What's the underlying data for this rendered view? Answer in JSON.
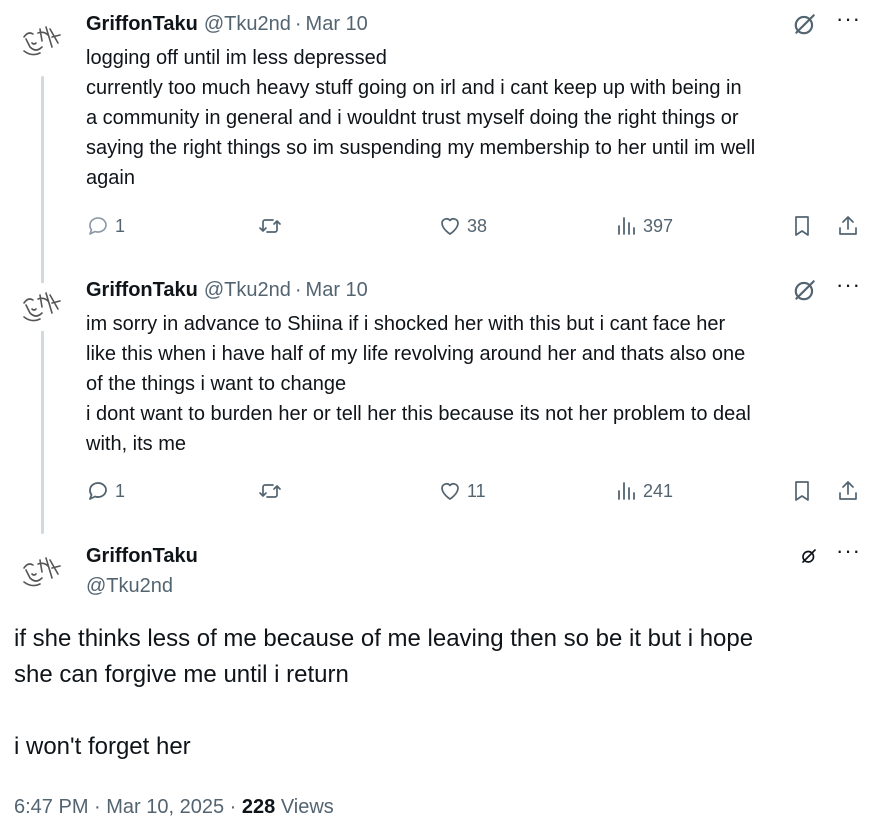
{
  "tweets": [
    {
      "name": "GriffonTaku",
      "handle": "@Tku2nd",
      "separator": "·",
      "date": "Mar 10",
      "lines": [
        "logging off until im less depressed",
        "currently too much heavy stuff going on irl and i cant keep up with being in",
        "a community in general and i wouldnt trust myself doing the right things or",
        "saying the right things so im suspending my membership to her until im well",
        "again"
      ],
      "replies": "1",
      "likes": "38",
      "views": "397"
    },
    {
      "name": "GriffonTaku",
      "handle": "@Tku2nd",
      "separator": "·",
      "date": "Mar 10",
      "lines": [
        "im sorry in advance to Shiina if i shocked her with this but i cant face her",
        "like this when i have half of my life revolving around her and thats also one",
        "of the things i want to change",
        "i dont want to burden her or tell her this because its not her problem to deal",
        "with, its me"
      ],
      "replies": "1",
      "likes": "11",
      "views": "241"
    }
  ],
  "main": {
    "name": "GriffonTaku",
    "handle": "@Tku2nd",
    "lines": [
      "if she thinks less of me because of me leaving then so be it but i hope",
      "she can forgive me until i return"
    ],
    "second_paragraph": "i won't forget her",
    "timestamp": "6:47 PM · Mar 10, 2025 · ",
    "views_count": "228",
    "views_label": " Views"
  },
  "icons": {
    "more": "more-icon",
    "grok": "grok-icon",
    "reply": "reply-icon",
    "retweet": "retweet-icon",
    "like": "like-icon",
    "views": "views-icon",
    "bookmark": "bookmark-icon",
    "share": "share-icon"
  },
  "colors": {
    "text": "#0f1419",
    "secondary": "#536471",
    "thread_line": "#cfd9de",
    "background": "#ffffff"
  }
}
